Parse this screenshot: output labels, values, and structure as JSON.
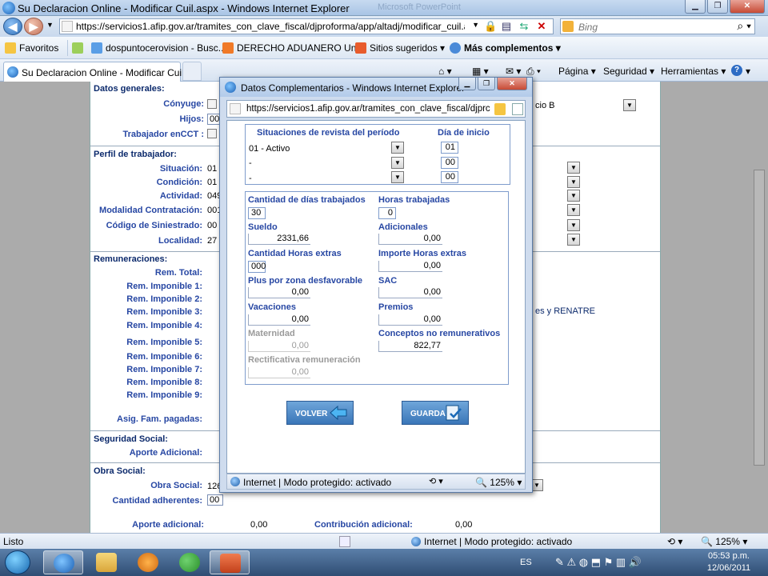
{
  "window": {
    "title": "Su Declaracion Online - Modificar Cuil.aspx - Windows Internet Explorer",
    "ghost_title": "Microsoft PowerPoint",
    "address": "https://servicios1.afip.gov.ar/tramites_con_clave_fiscal/djproforma/app/altadj/modificar_cuil.aspx",
    "search_placeholder": "Bing"
  },
  "favorites": {
    "favoritos_label": "Favoritos",
    "items": [
      "dospuntocerovision - Busc...",
      "DERECHO ADUANERO Un...",
      "Sitios sugeridos ▾",
      "Más complementos ▾"
    ]
  },
  "tab": {
    "label": "Su Declaracion Online - Modificar Cuil..."
  },
  "commandbar": {
    "pagina": "Página ▾",
    "seguridad": "Seguridad ▾",
    "herramientas": "Herramientas ▾",
    "help": "?"
  },
  "page": {
    "datos_generales": "Datos generales:",
    "conyuge": "Cónyuge:",
    "hijos": "Hijos:",
    "hijos_val": "00",
    "trabajador_cct": "Trabajador enCCT :",
    "perfil": "Perfil de trabajador:",
    "situacion": "Situación:",
    "situacion_val": "01",
    "condicion": "Condición:",
    "condicion_val": "01",
    "actividad": "Actividad:",
    "actividad_val": "049",
    "modalidad": "Modalidad Contratación:",
    "modalidad_val": "001",
    "siniestrado": "Código de Siniestrado:",
    "siniestrado_val": "00",
    "localidad": "Localidad:",
    "localidad_val": "27",
    "right_text_1": "cio B",
    "right_text_2": "es y RENATRE",
    "remuneraciones": "Remuneraciones:",
    "rem_total": "Rem. Total:",
    "rem_imponibles": [
      "Rem. Imponible 1:",
      "Rem. Imponible 2:",
      "Rem. Imponible 3:",
      "Rem. Imponible 4:",
      "Rem. Imponible 5:",
      "Rem. Imponible 6:",
      "Rem. Imponible 7:",
      "Rem. Imponible 8:",
      "Rem. Imponible 9:"
    ],
    "asig_fam": "Asig. Fam. pagadas:",
    "seguridad_social": "Seguridad Social:",
    "aporte_adicional_ss": "Aporte Adicional:",
    "obra_social": "Obra Social:",
    "obra_social_lbl": "Obra Social:",
    "obra_social_val": "126",
    "cant_adherentes": "Cantidad adherentes:",
    "cant_adherentes_val": "00",
    "aporte_adicional": "Aporte adicional:",
    "aporte_adicional_val": "0,00",
    "contribucion_adicional": "Contribución adicional:",
    "contribucion_adicional_val": "0,00"
  },
  "modal": {
    "title": "Datos Complementarios - Windows Internet Explorer",
    "address": "https://servicios1.afip.gov.ar/tramites_con_clave_fiscal/djprc",
    "situaciones_header": "Situaciones de revista del período",
    "dia_header": "Día de inicio",
    "situaciones": [
      {
        "value": "01 - Activo",
        "dia": "01"
      },
      {
        "value": "-",
        "dia": "00"
      },
      {
        "value": "-",
        "dia": "00"
      }
    ],
    "fields": {
      "dias_trabajados_lbl": "Cantidad de días trabajados",
      "dias_trabajados_val": "30",
      "horas_trabajadas_lbl": "Horas trabajadas",
      "horas_trabajadas_val": "0",
      "sueldo_lbl": "Sueldo",
      "sueldo_val": "2331,66",
      "adicionales_lbl": "Adicionales",
      "adicionales_val": "0,00",
      "cant_horas_extras_lbl": "Cantidad Horas extras",
      "cant_horas_extras_val": "000",
      "importe_horas_extras_lbl": "Importe Horas extras",
      "importe_horas_extras_val": "0,00",
      "plus_zona_lbl": "Plus por zona desfavorable",
      "plus_zona_val": "0,00",
      "sac_lbl": "SAC",
      "sac_val": "0,00",
      "vacaciones_lbl": "Vacaciones",
      "vacaciones_val": "0,00",
      "premios_lbl": "Premios",
      "premios_val": "0,00",
      "maternidad_lbl": "Maternidad",
      "maternidad_val": "0,00",
      "conceptos_no_rem_lbl": "Conceptos no remunerativos",
      "conceptos_no_rem_val": "822,77",
      "rectificativa_lbl": "Rectificativa  remuneración",
      "rectificativa_val": "0,00"
    },
    "volver_label": "VOLVER",
    "guardar_label": "GUARDAR",
    "status": "Internet | Modo protegido: activado",
    "zoom": "125%"
  },
  "statusbar": {
    "left": "Listo",
    "zone": "Internet | Modo protegido: activado",
    "zoom": "125%"
  },
  "taskbar": {
    "lang": "ES",
    "time": "05:53 p.m.",
    "date": "12/06/2011"
  }
}
